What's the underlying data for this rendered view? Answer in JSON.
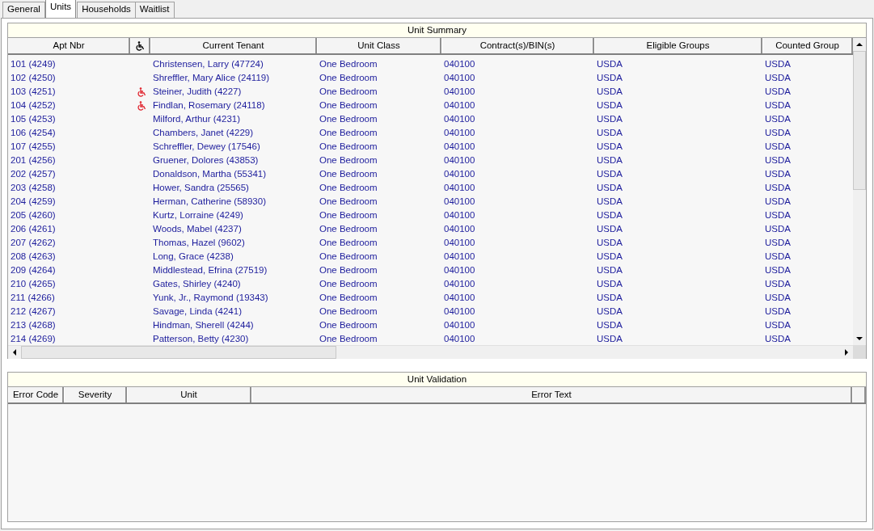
{
  "tabs": [
    {
      "label": "General",
      "selected": false
    },
    {
      "label": "Units",
      "selected": true
    },
    {
      "label": "Households",
      "selected": false
    },
    {
      "label": "Waitlist",
      "selected": false
    }
  ],
  "unit_summary": {
    "title": "Unit Summary",
    "columns": [
      {
        "label": "Apt Nbr",
        "kind": "text"
      },
      {
        "kind": "accessible"
      },
      {
        "label": "Current Tenant",
        "kind": "text"
      },
      {
        "label": "Unit Class",
        "kind": "text"
      },
      {
        "label": "Contract(s)/BIN(s)",
        "kind": "text"
      },
      {
        "label": "Eligible Groups",
        "kind": "text"
      },
      {
        "label": "Counted Group",
        "kind": "text"
      }
    ],
    "rows": [
      {
        "apt": "101 (4249)",
        "accessible": false,
        "tenant": "Christensen, Larry (47724)",
        "unit_class": "One Bedroom",
        "contract": "040100",
        "eligible": "USDA",
        "counted": "USDA"
      },
      {
        "apt": "102 (4250)",
        "accessible": false,
        "tenant": "Shreffler, Mary Alice (24119)",
        "unit_class": "One Bedroom",
        "contract": "040100",
        "eligible": "USDA",
        "counted": "USDA"
      },
      {
        "apt": "103 (4251)",
        "accessible": true,
        "tenant": "Steiner, Judith (4227)",
        "unit_class": "One Bedroom",
        "contract": "040100",
        "eligible": "USDA",
        "counted": "USDA"
      },
      {
        "apt": "104 (4252)",
        "accessible": true,
        "tenant": "Findlan, Rosemary (24118)",
        "unit_class": "One Bedroom",
        "contract": "040100",
        "eligible": "USDA",
        "counted": "USDA"
      },
      {
        "apt": "105 (4253)",
        "accessible": false,
        "tenant": "Milford, Arthur (4231)",
        "unit_class": "One Bedroom",
        "contract": "040100",
        "eligible": "USDA",
        "counted": "USDA"
      },
      {
        "apt": "106 (4254)",
        "accessible": false,
        "tenant": "Chambers, Janet (4229)",
        "unit_class": "One Bedroom",
        "contract": "040100",
        "eligible": "USDA",
        "counted": "USDA"
      },
      {
        "apt": "107 (4255)",
        "accessible": false,
        "tenant": "Schreffler, Dewey (17546)",
        "unit_class": "One Bedroom",
        "contract": "040100",
        "eligible": "USDA",
        "counted": "USDA"
      },
      {
        "apt": "201 (4256)",
        "accessible": false,
        "tenant": "Gruener, Dolores (43853)",
        "unit_class": "One Bedroom",
        "contract": "040100",
        "eligible": "USDA",
        "counted": "USDA"
      },
      {
        "apt": "202 (4257)",
        "accessible": false,
        "tenant": "Donaldson, Martha (55341)",
        "unit_class": "One Bedroom",
        "contract": "040100",
        "eligible": "USDA",
        "counted": "USDA"
      },
      {
        "apt": "203 (4258)",
        "accessible": false,
        "tenant": "Hower, Sandra (25565)",
        "unit_class": "One Bedroom",
        "contract": "040100",
        "eligible": "USDA",
        "counted": "USDA"
      },
      {
        "apt": "204 (4259)",
        "accessible": false,
        "tenant": "Herman, Catherine (58930)",
        "unit_class": "One Bedroom",
        "contract": "040100",
        "eligible": "USDA",
        "counted": "USDA"
      },
      {
        "apt": "205 (4260)",
        "accessible": false,
        "tenant": "Kurtz, Lorraine (4249)",
        "unit_class": "One Bedroom",
        "contract": "040100",
        "eligible": "USDA",
        "counted": "USDA"
      },
      {
        "apt": "206 (4261)",
        "accessible": false,
        "tenant": "Woods, Mabel (4237)",
        "unit_class": "One Bedroom",
        "contract": "040100",
        "eligible": "USDA",
        "counted": "USDA"
      },
      {
        "apt": "207 (4262)",
        "accessible": false,
        "tenant": "Thomas, Hazel (9602)",
        "unit_class": "One Bedroom",
        "contract": "040100",
        "eligible": "USDA",
        "counted": "USDA"
      },
      {
        "apt": "208 (4263)",
        "accessible": false,
        "tenant": "Long, Grace (4238)",
        "unit_class": "One Bedroom",
        "contract": "040100",
        "eligible": "USDA",
        "counted": "USDA"
      },
      {
        "apt": "209 (4264)",
        "accessible": false,
        "tenant": "Middlestead, Efrina (27519)",
        "unit_class": "One Bedroom",
        "contract": "040100",
        "eligible": "USDA",
        "counted": "USDA"
      },
      {
        "apt": "210 (4265)",
        "accessible": false,
        "tenant": "Gates, Shirley (4240)",
        "unit_class": "One Bedroom",
        "contract": "040100",
        "eligible": "USDA",
        "counted": "USDA"
      },
      {
        "apt": "211 (4266)",
        "accessible": false,
        "tenant": "Yunk, Jr., Raymond (19343)",
        "unit_class": "One Bedroom",
        "contract": "040100",
        "eligible": "USDA",
        "counted": "USDA"
      },
      {
        "apt": "212 (4267)",
        "accessible": false,
        "tenant": "Savage, Linda (4241)",
        "unit_class": "One Bedroom",
        "contract": "040100",
        "eligible": "USDA",
        "counted": "USDA"
      },
      {
        "apt": "213 (4268)",
        "accessible": false,
        "tenant": "Hindman, Sherell (4244)",
        "unit_class": "One Bedroom",
        "contract": "040100",
        "eligible": "USDA",
        "counted": "USDA"
      },
      {
        "apt": "214 (4269)",
        "accessible": false,
        "tenant": "Patterson, Betty (4230)",
        "unit_class": "One Bedroom",
        "contract": "040100",
        "eligible": "USDA",
        "counted": "USDA"
      }
    ]
  },
  "unit_validation": {
    "title": "Unit Validation",
    "columns": [
      "Error Code",
      "Severity",
      "Unit",
      "Error Text"
    ]
  }
}
